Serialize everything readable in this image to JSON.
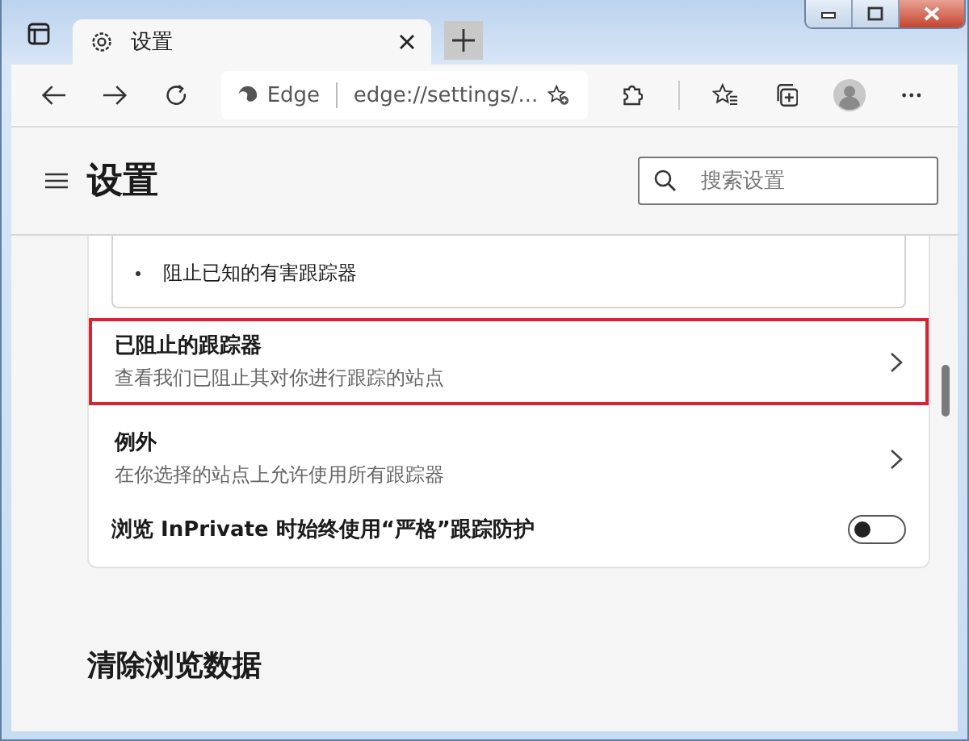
{
  "tab": {
    "label": "设置",
    "selected": true
  },
  "address_bar": {
    "site_label": "Edge",
    "url": "edge://settings/..."
  },
  "settings_header": {
    "title": "设置",
    "search": {
      "placeholder": "搜索设置"
    }
  },
  "tracking_card": {
    "bullets": [
      "阻止已知的有害跟踪器"
    ],
    "rows": [
      {
        "kind": "link",
        "title": "已阻止的跟踪器",
        "description": "查看我们已阻止其对你进行跟踪的站点",
        "highlighted": true
      },
      {
        "kind": "link",
        "title": "例外",
        "description": "在你选择的站点上允许使用所有跟踪器",
        "highlighted": false
      },
      {
        "kind": "toggle",
        "title": "浏览 InPrivate 时始终使用“严格”跟踪防护",
        "on": false
      }
    ]
  },
  "clear_section": {
    "title": "清除浏览数据"
  }
}
